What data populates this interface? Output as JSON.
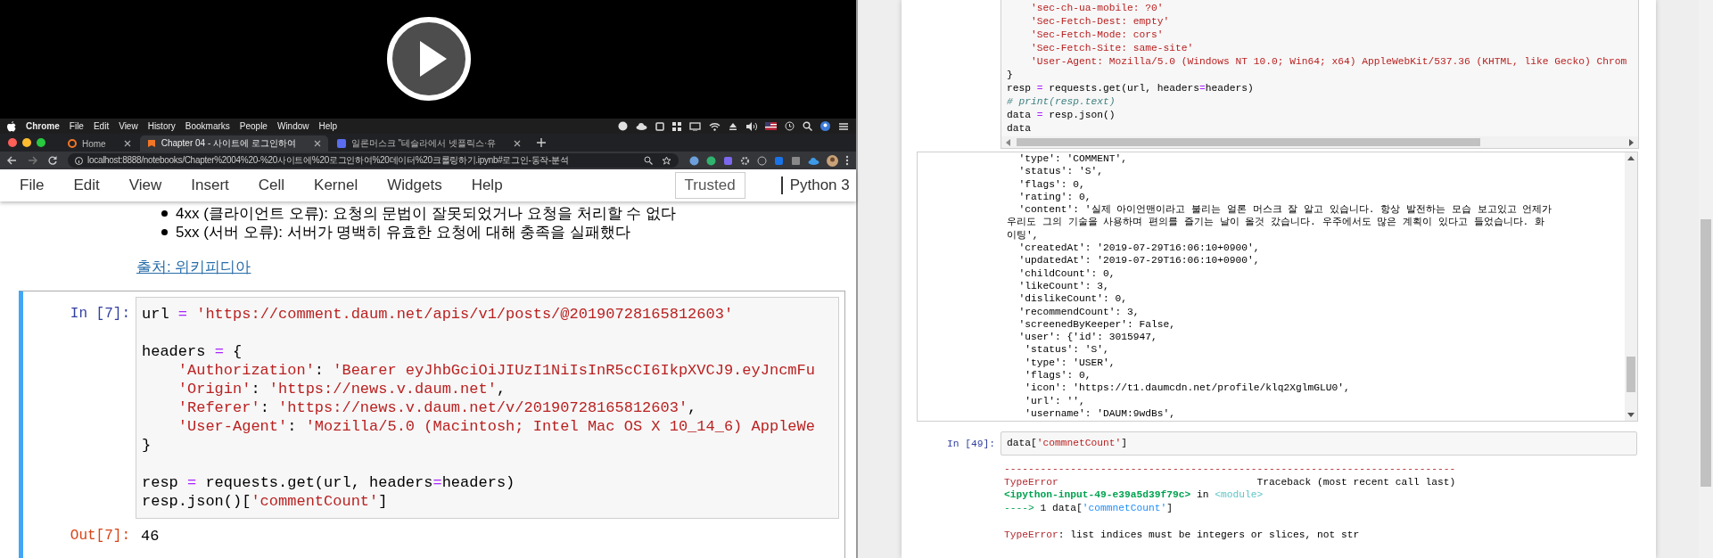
{
  "video": {
    "menu_bar": {
      "app": "Chrome",
      "items": [
        "File",
        "Edit",
        "View",
        "History",
        "Bookmarks",
        "People",
        "Window",
        "Help"
      ]
    },
    "browser_tabs": [
      {
        "title": "Home",
        "selected": false
      },
      {
        "title": "Chapter 04 - 사이트에 로그인하여",
        "selected": true
      },
      {
        "title": "일론머스크 \"테슬라에서 넷플릭스·유",
        "selected": false
      }
    ],
    "address": "localhost:8888/notebooks/Chapter%2004%20-%20사이트에%20로그인하여%20데이터%20크롤링하기.ipynb#로그인-동작-분석",
    "notebook_menu": [
      "File",
      "Edit",
      "View",
      "Insert",
      "Cell",
      "Kernel",
      "Widgets",
      "Help"
    ],
    "trusted": "Trusted",
    "kernel": "Python 3",
    "bullets": [
      "4xx (클라이언트 오류): 요청의 문법이 잘못되었거나 요청을 처리할 수 없다",
      "5xx (서버 오류): 서버가 명백히 유효한 요청에 대해 충족을 실패했다"
    ],
    "link": "출처: 위키피디아",
    "cell": {
      "prompt": "In [7]:",
      "blocks": [
        [
          [
            {
              "kind": "name",
              "text": "url "
            },
            {
              "kind": "op",
              "text": "="
            },
            {
              "kind": "str",
              "text": " 'https://comment.daum.net/apis/v1/posts/@20190728165812603'"
            }
          ]
        ],
        [
          [
            {
              "kind": "name",
              "text": "headers "
            },
            {
              "kind": "op",
              "text": "="
            },
            {
              "kind": "name",
              "text": " {"
            }
          ],
          [
            {
              "kind": "str",
              "text": "    'Authorization'"
            },
            {
              "kind": "name",
              "text": ": "
            },
            {
              "kind": "str",
              "text": "'Bearer eyJhbGciOiJIUzI1NiIsInR5cCI6IkpXVCJ9.eyJncmFu"
            }
          ],
          [
            {
              "kind": "str",
              "text": "    'Origin'"
            },
            {
              "kind": "name",
              "text": ": "
            },
            {
              "kind": "str",
              "text": "'https://news.v.daum.net'"
            },
            {
              "kind": "name",
              "text": ","
            }
          ],
          [
            {
              "kind": "str",
              "text": "    'Referer'"
            },
            {
              "kind": "name",
              "text": ": "
            },
            {
              "kind": "str",
              "text": "'https://news.v.daum.net/v/20190728165812603'"
            },
            {
              "kind": "name",
              "text": ","
            }
          ],
          [
            {
              "kind": "str",
              "text": "    'User-Agent'"
            },
            {
              "kind": "name",
              "text": ": "
            },
            {
              "kind": "str",
              "text": "'Mozilla/5.0 (Macintosh; Intel Mac OS X 10_14_6) AppleWe"
            }
          ],
          [
            {
              "kind": "name",
              "text": "}"
            }
          ]
        ],
        [
          [
            {
              "kind": "name",
              "text": "resp "
            },
            {
              "kind": "op",
              "text": "="
            },
            {
              "kind": "name",
              "text": " requests.get(url, headers"
            },
            {
              "kind": "op",
              "text": "="
            },
            {
              "kind": "name",
              "text": "headers)"
            }
          ],
          [
            {
              "kind": "name",
              "text": "resp.json()["
            },
            {
              "kind": "str",
              "text": "'commentCount'"
            },
            {
              "kind": "name",
              "text": "]"
            }
          ]
        ]
      ],
      "out_prompt": "Out[7]:",
      "output": "46"
    }
  },
  "notebook": {
    "code_cell": {
      "lines": [
        [
          {
            "kind": "str",
            "text": "    'sec-ch-ua-mobile: ?0'"
          }
        ],
        [
          {
            "kind": "str",
            "text": "    'Sec-Fetch-Dest: empty'"
          }
        ],
        [
          {
            "kind": "str",
            "text": "    'Sec-Fetch-Mode: cors'"
          }
        ],
        [
          {
            "kind": "str",
            "text": "    'Sec-Fetch-Site: same-site'"
          }
        ],
        [
          {
            "kind": "str",
            "text": "    'User-Agent: Mozilla/5.0 (Windows NT 10.0; Win64; x64) AppleWebKit/537.36 (KHTML, like Gecko) Chrom"
          }
        ],
        [
          {
            "kind": "name",
            "text": "}"
          }
        ],
        [
          {
            "kind": "name",
            "text": "resp "
          },
          {
            "kind": "op",
            "text": "="
          },
          {
            "kind": "name",
            "text": " requests.get(url, headers"
          },
          {
            "kind": "op",
            "text": "="
          },
          {
            "kind": "name",
            "text": "headers)"
          }
        ],
        [
          {
            "kind": "comment",
            "text": "# print(resp.text)"
          }
        ],
        [
          {
            "kind": "name",
            "text": "data "
          },
          {
            "kind": "op",
            "text": "="
          },
          {
            "kind": "name",
            "text": " resp.json()"
          }
        ],
        [
          {
            "kind": "name",
            "text": "data"
          }
        ]
      ]
    },
    "output_lines": [
      "  'type': 'COMMENT',",
      "  'status': 'S',",
      "  'flags': 0,",
      "  'rating': 0,",
      "  'content': '실제 아이언맨이라고 불리는 얼론 머스크 잘 알고 있습니다. 항상 발전하는 모습 보고있고 언제가",
      "우리도 그의 기술을 사용하며 편의를 즐기는 날이 올것 갔습니다. 우주에서도 많은 계획이 있다고 들었습니다. 화",
      "이팅',",
      "  'createdAt': '2019-07-29T16:06:10+0900',",
      "  'updatedAt': '2019-07-29T16:06:10+0900',",
      "  'childCount': 0,",
      "  'likeCount': 3,",
      "  'dislikeCount': 0,",
      "  'recommendCount': 3,",
      "  'screenedByKeeper': False,",
      "  'user': {'id': 3015947,",
      "   'status': 'S',",
      "   'type': 'USER',",
      "   'flags': 0,",
      "   'icon': 'https://t1.daumcdn.net/profile/klq2XglmGLU0',",
      "   'url': '',",
      "   'username': 'DAUM:9wdBs',"
    ],
    "cell": {
      "prompt": "In [49]:",
      "code": [
        {
          "kind": "name",
          "text": "data["
        },
        {
          "kind": "str",
          "text": "'commnetCount'"
        },
        {
          "kind": "name",
          "text": "]"
        }
      ]
    },
    "error_blocks": [
      [
        [
          {
            "kind": "err",
            "text": "---------------------------------------------------------------------------"
          }
        ],
        [
          {
            "kind": "err",
            "text": "TypeError"
          },
          {
            "kind": "name",
            "text": "                                 Traceback (most recent call last)"
          }
        ],
        [
          {
            "kind": "errgreen",
            "text": "<ipython-input-49-e39a5d39f79c>"
          },
          {
            "kind": "name",
            "text": " in "
          },
          {
            "kind": "cyan",
            "text": "<module>"
          }
        ],
        [
          {
            "kind": "green",
            "text": "---->"
          },
          {
            "kind": "name",
            "text": " 1 data["
          },
          {
            "kind": "blue",
            "text": "'commnetCount'"
          },
          {
            "kind": "name",
            "text": "]"
          }
        ]
      ],
      [
        [
          {
            "kind": "err",
            "text": "TypeError"
          },
          {
            "kind": "name",
            "text": ": list indices must be integers or slices, not str"
          }
        ]
      ]
    ]
  }
}
